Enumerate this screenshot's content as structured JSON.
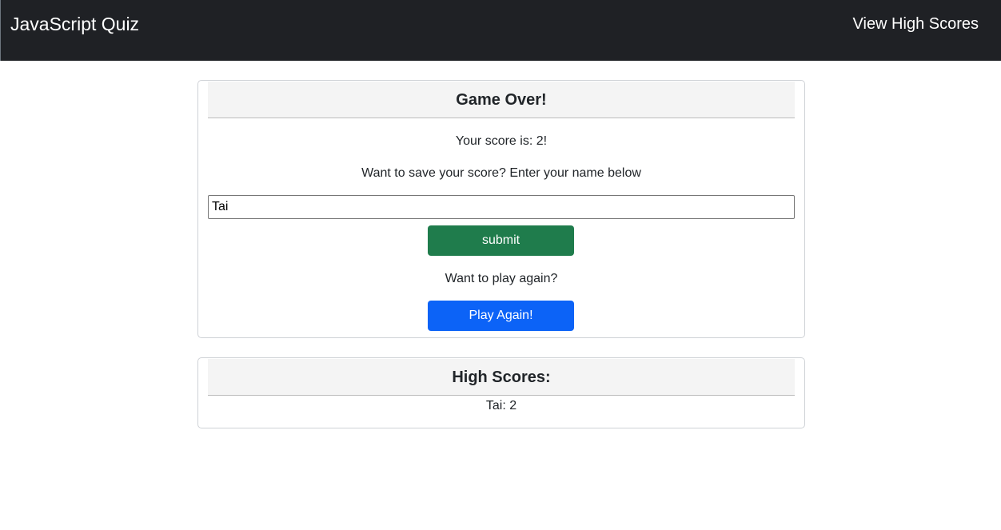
{
  "navbar": {
    "brand": "JavaScript Quiz",
    "high_scores_link": "View High Scores"
  },
  "game_over": {
    "title": "Game Over!",
    "score_text": "Your score is: 2!",
    "save_prompt": "Want to save your score? Enter your name below",
    "name_input_value": "Tai",
    "submit_label": "submit",
    "play_again_prompt": "Want to play again?",
    "play_again_label": "Play Again!"
  },
  "high_scores": {
    "title": "High Scores:",
    "entries": [
      "Tai: 2"
    ]
  },
  "colors": {
    "navbar_bg": "#1f2125",
    "submit_button": "#1f7c4c",
    "play_again_button": "#0c63f7"
  }
}
